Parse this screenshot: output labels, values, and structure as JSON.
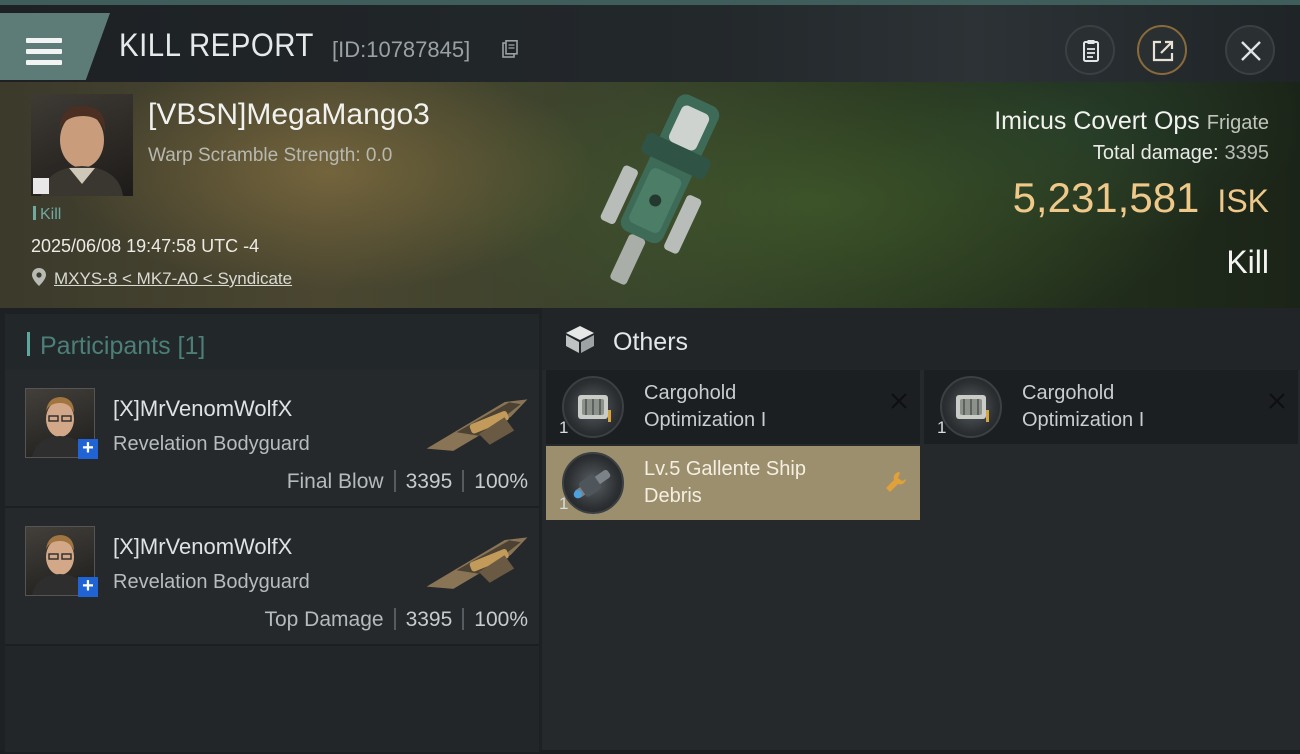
{
  "header": {
    "title": "KILL REPORT",
    "report_id": "[ID:10787845]"
  },
  "victim": {
    "name": "[VBSN]MegaMango3",
    "warp_scramble": "Warp Scramble Strength: 0.0",
    "tag": "Kill",
    "datetime": "2025/06/08 19:47:58 UTC -4",
    "location": "MXYS-8 < MK7-A0 < Syndicate"
  },
  "ship": {
    "name": "Imicus Covert Ops",
    "class": "Frigate",
    "total_damage_label": "Total damage:",
    "total_damage": "3395",
    "isk_value": "5,231,581",
    "isk_unit": "ISK",
    "result": "Kill"
  },
  "participants": {
    "title": "Participants [1]",
    "rows": [
      {
        "name": "[X]MrVenomWolfX",
        "ship": "Revelation Bodyguard",
        "tag": "Final Blow",
        "damage": "3395",
        "percent": "100%"
      },
      {
        "name": "[X]MrVenomWolfX",
        "ship": "Revelation Bodyguard",
        "tag": "Top Damage",
        "damage": "3395",
        "percent": "100%"
      }
    ]
  },
  "others": {
    "title": "Others",
    "items": [
      {
        "name_line1": "Cargohold",
        "name_line2": "Optimization I",
        "qty": "1",
        "status_icon": "destroyed-x-icon"
      },
      {
        "name_line1": "Cargohold",
        "name_line2": "Optimization I",
        "qty": "1",
        "status_icon": "destroyed-x-icon"
      },
      {
        "name_line1": "Lv.5 Gallente Ship",
        "name_line2": "Debris",
        "qty": "1",
        "status_icon": "wrench-icon"
      }
    ]
  },
  "colors": {
    "accent_teal": "#5d7c78",
    "isk_gold": "#eec98a",
    "blueprint_bg": "#9c8f6e"
  }
}
